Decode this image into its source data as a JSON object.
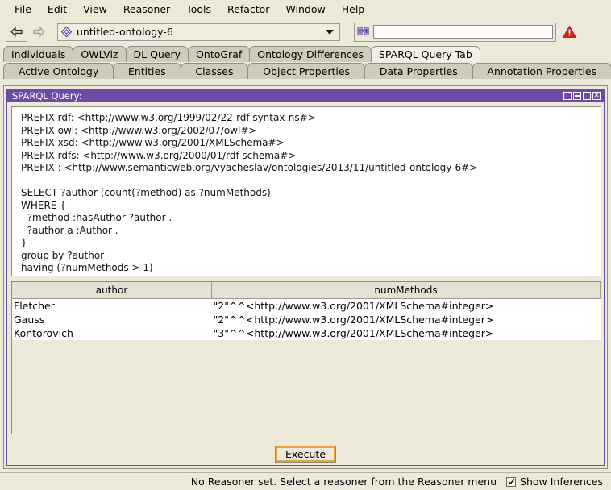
{
  "menubar": {
    "items": [
      {
        "label": "File"
      },
      {
        "label": "Edit"
      },
      {
        "label": "View"
      },
      {
        "label": "Reasoner"
      },
      {
        "label": "Tools"
      },
      {
        "label": "Refactor"
      },
      {
        "label": "Window"
      },
      {
        "label": "Help"
      }
    ]
  },
  "toolbar": {
    "back_icon": "back-arrow-icon",
    "forward_icon": "forward-arrow-icon",
    "ontology_icon": "ontology-diamond-icon",
    "ontology_label": "untitled-ontology-6",
    "search_icon": "binoculars-icon",
    "search_value": "",
    "search_placeholder": "",
    "warning_icon": "warning-triangle-icon",
    "accent_purple": "#6B4BA3",
    "warning_color": "#D42020"
  },
  "tabs": {
    "row1": [
      {
        "label": "Individuals",
        "selected": false
      },
      {
        "label": "OWLViz",
        "selected": false
      },
      {
        "label": "DL Query",
        "selected": false
      },
      {
        "label": "OntoGraf",
        "selected": false
      },
      {
        "label": "Ontology Differences",
        "selected": false
      },
      {
        "label": "SPARQL Query Tab",
        "selected": true
      }
    ],
    "row2": [
      {
        "label": "Active Ontology",
        "selected": false
      },
      {
        "label": "Entities",
        "selected": false
      },
      {
        "label": "Classes",
        "selected": false
      },
      {
        "label": "Object Properties",
        "selected": false
      },
      {
        "label": "Data Properties",
        "selected": false
      },
      {
        "label": "Annotation Properties",
        "selected": false
      }
    ]
  },
  "panel": {
    "title": "SPARQL Query:",
    "controls": [
      {
        "name": "split-view-icon"
      },
      {
        "name": "minimize-icon"
      },
      {
        "name": "maximize-icon"
      },
      {
        "name": "close-icon"
      }
    ],
    "query_text": "PREFIX rdf: <http://www.w3.org/1999/02/22-rdf-syntax-ns#>\nPREFIX owl: <http://www.w3.org/2002/07/owl#>\nPREFIX xsd: <http://www.w3.org/2001/XMLSchema#>\nPREFIX rdfs: <http://www.w3.org/2000/01/rdf-schema#>\nPREFIX : <http://www.semanticweb.org/vyacheslav/ontologies/2013/11/untitled-ontology-6#>\n\nSELECT ?author (count(?method) as ?numMethods)\nWHERE {\n  ?method :hasAuthor ?author .\n  ?author a :Author .\n}\ngroup by ?author\nhaving (?numMethods > 1)",
    "execute_label": "Execute"
  },
  "results": {
    "columns": [
      "author",
      "numMethods"
    ],
    "rows": [
      {
        "author": "Fletcher",
        "numMethods": "\"2\"^^<http://www.w3.org/2001/XMLSchema#integer>"
      },
      {
        "author": "Gauss",
        "numMethods": "\"2\"^^<http://www.w3.org/2001/XMLSchema#integer>"
      },
      {
        "author": "Kontorovich",
        "numMethods": "\"3\"^^<http://www.w3.org/2001/XMLSchema#integer>"
      }
    ]
  },
  "statusbar": {
    "message": "No Reasoner set. Select a reasoner from the Reasoner menu",
    "checkbox_label": "Show Inferences",
    "checkbox_checked": true
  }
}
